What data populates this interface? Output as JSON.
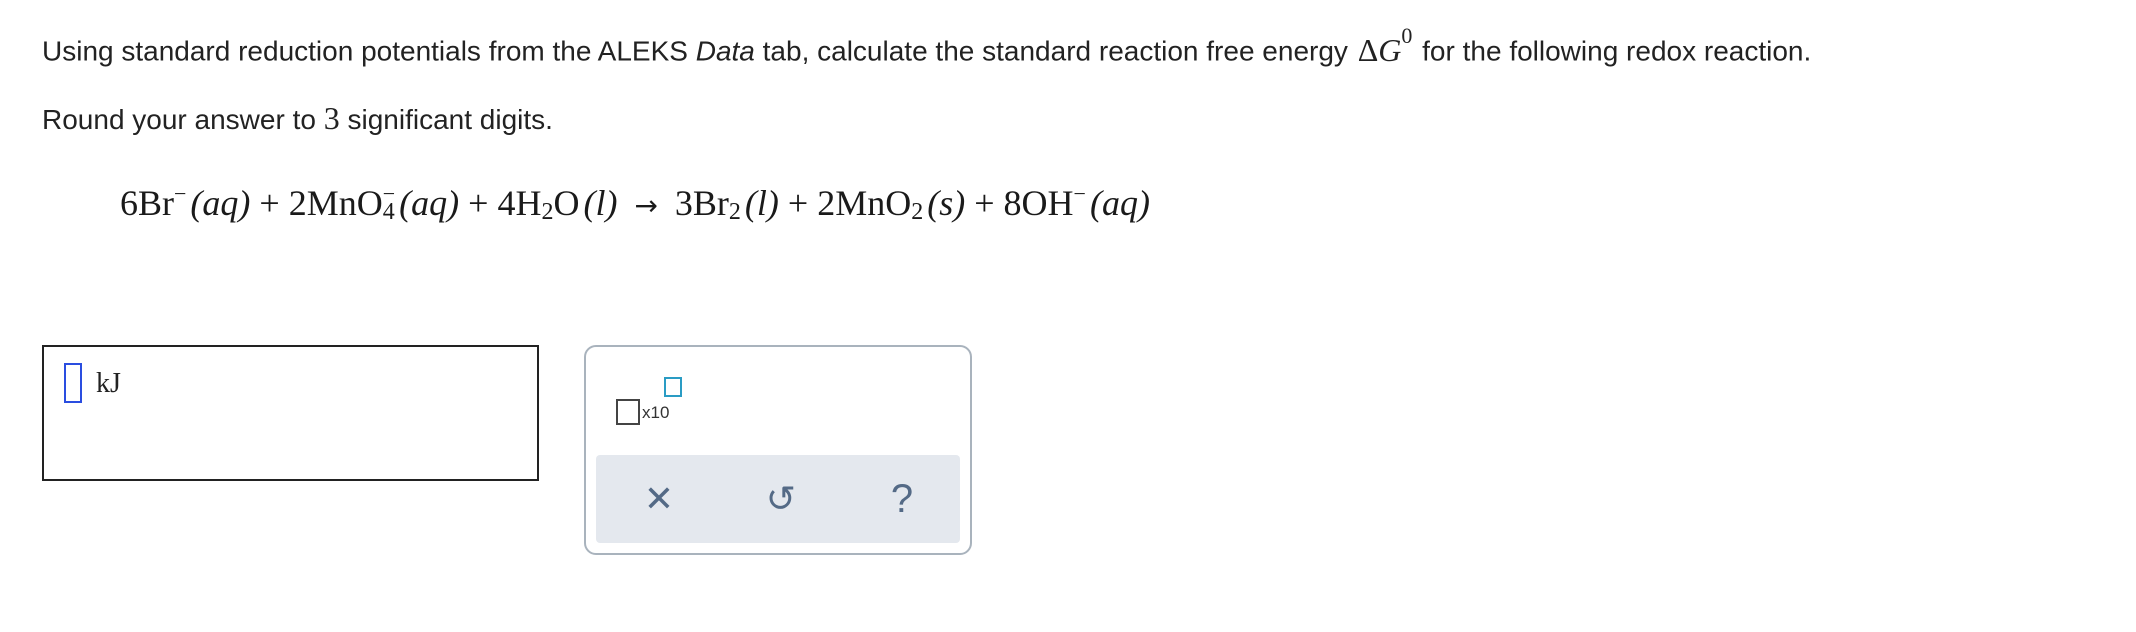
{
  "question": {
    "text_before_data": "Using standard reduction potentials from the ALEKS ",
    "data_word": "Data",
    "text_after_data": " tab, calculate the standard reaction free energy ",
    "symbol_delta": "Δ",
    "symbol_g": "G",
    "symbol_superscript": "0",
    "text_end": " for the following redox reaction."
  },
  "rounding": {
    "prefix": "Round your answer to ",
    "digits": "3",
    "suffix": " significant digits."
  },
  "equation": {
    "t1_coef": "6Br",
    "t1_charge": "−",
    "t1_state": "(aq)",
    "plus1": "+",
    "t2_coef": "2MnO",
    "t2_sub": "4",
    "t2_charge": "−",
    "t2_state": "(aq)",
    "plus2": "+",
    "t3_coef": "4H",
    "t3_sub": "2",
    "t3_tail": "O",
    "t3_state": "(l)",
    "arrow": "→",
    "p1_coef": "3Br",
    "p1_sub": "2",
    "p1_state": "(l)",
    "plus3": "+",
    "p2_coef": "2MnO",
    "p2_sub": "2",
    "p2_state": "(s)",
    "plus4": "+",
    "p3_coef": "8OH",
    "p3_charge": "−",
    "p3_state": "(aq)"
  },
  "answer": {
    "value": "",
    "unit": "kJ"
  },
  "palette": {
    "sci_notation_label": "x10",
    "clear_icon": "✕",
    "undo_icon": "↺",
    "help_icon": "?",
    "accent_color": "#2a9cc4",
    "icon_color": "#546a86",
    "cursor_color": "#2a4de0"
  }
}
